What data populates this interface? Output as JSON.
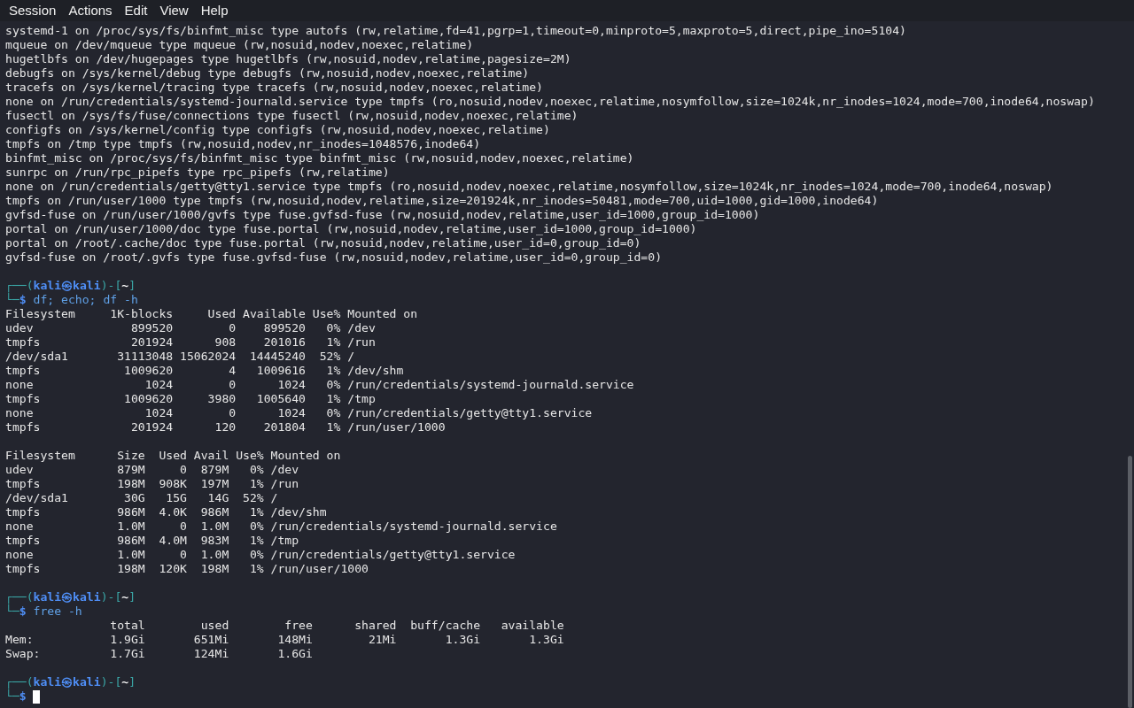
{
  "menu": [
    "Session",
    "Actions",
    "Edit",
    "View",
    "Help"
  ],
  "lines": [
    {
      "kind": "output",
      "text": "systemd-1 on /proc/sys/fs/binfmt_misc type autofs (rw,relatime,fd=41,pgrp=1,timeout=0,minproto=5,maxproto=5,direct,pipe_ino=5104)"
    },
    {
      "kind": "output",
      "text": "mqueue on /dev/mqueue type mqueue (rw,nosuid,nodev,noexec,relatime)"
    },
    {
      "kind": "output",
      "text": "hugetlbfs on /dev/hugepages type hugetlbfs (rw,nosuid,nodev,relatime,pagesize=2M)"
    },
    {
      "kind": "output",
      "text": "debugfs on /sys/kernel/debug type debugfs (rw,nosuid,nodev,noexec,relatime)"
    },
    {
      "kind": "output",
      "text": "tracefs on /sys/kernel/tracing type tracefs (rw,nosuid,nodev,noexec,relatime)"
    },
    {
      "kind": "output",
      "text": "none on /run/credentials/systemd-journald.service type tmpfs (ro,nosuid,nodev,noexec,relatime,nosymfollow,size=1024k,nr_inodes=1024,mode=700,inode64,noswap)"
    },
    {
      "kind": "output",
      "text": "fusectl on /sys/fs/fuse/connections type fusectl (rw,nosuid,nodev,noexec,relatime)"
    },
    {
      "kind": "output",
      "text": "configfs on /sys/kernel/config type configfs (rw,nosuid,nodev,noexec,relatime)"
    },
    {
      "kind": "output",
      "text": "tmpfs on /tmp type tmpfs (rw,nosuid,nodev,nr_inodes=1048576,inode64)"
    },
    {
      "kind": "output",
      "text": "binfmt_misc on /proc/sys/fs/binfmt_misc type binfmt_misc (rw,nosuid,nodev,noexec,relatime)"
    },
    {
      "kind": "output",
      "text": "sunrpc on /run/rpc_pipefs type rpc_pipefs (rw,relatime)"
    },
    {
      "kind": "output",
      "text": "none on /run/credentials/getty@tty1.service type tmpfs (ro,nosuid,nodev,noexec,relatime,nosymfollow,size=1024k,nr_inodes=1024,mode=700,inode64,noswap)"
    },
    {
      "kind": "output",
      "text": "tmpfs on /run/user/1000 type tmpfs (rw,nosuid,nodev,relatime,size=201924k,nr_inodes=50481,mode=700,uid=1000,gid=1000,inode64)"
    },
    {
      "kind": "output",
      "text": "gvfsd-fuse on /run/user/1000/gvfs type fuse.gvfsd-fuse (rw,nosuid,nodev,relatime,user_id=1000,group_id=1000)"
    },
    {
      "kind": "output",
      "text": "portal on /run/user/1000/doc type fuse.portal (rw,nosuid,nodev,relatime,user_id=1000,group_id=1000)"
    },
    {
      "kind": "output",
      "text": "portal on /root/.cache/doc type fuse.portal (rw,nosuid,nodev,relatime,user_id=0,group_id=0)"
    },
    {
      "kind": "output",
      "text": "gvfsd-fuse on /root/.gvfs type fuse.gvfsd-fuse (rw,nosuid,nodev,relatime,user_id=0,group_id=0)"
    },
    {
      "kind": "blank"
    },
    {
      "kind": "prompt",
      "open": "┌──(",
      "user": "kali",
      "at": "㉿",
      "host": "kali",
      "mid": ")-[",
      "dir": "~",
      "close": "]",
      "mark": "└─$",
      "command": "df; echo; df -h",
      "cursor": false
    },
    {
      "kind": "output",
      "text": "Filesystem     1K-blocks     Used Available Use% Mounted on"
    },
    {
      "kind": "output",
      "text": "udev              899520        0    899520   0% /dev"
    },
    {
      "kind": "output",
      "text": "tmpfs             201924      908    201016   1% /run"
    },
    {
      "kind": "output",
      "text": "/dev/sda1       31113048 15062024  14445240  52% /"
    },
    {
      "kind": "output",
      "text": "tmpfs            1009620        4   1009616   1% /dev/shm"
    },
    {
      "kind": "output",
      "text": "none                1024        0      1024   0% /run/credentials/systemd-journald.service"
    },
    {
      "kind": "output",
      "text": "tmpfs            1009620     3980   1005640   1% /tmp"
    },
    {
      "kind": "output",
      "text": "none                1024        0      1024   0% /run/credentials/getty@tty1.service"
    },
    {
      "kind": "output",
      "text": "tmpfs             201924      120    201804   1% /run/user/1000"
    },
    {
      "kind": "blank"
    },
    {
      "kind": "output",
      "text": "Filesystem      Size  Used Avail Use% Mounted on"
    },
    {
      "kind": "output",
      "text": "udev            879M     0  879M   0% /dev"
    },
    {
      "kind": "output",
      "text": "tmpfs           198M  908K  197M   1% /run"
    },
    {
      "kind": "output",
      "text": "/dev/sda1        30G   15G   14G  52% /"
    },
    {
      "kind": "output",
      "text": "tmpfs           986M  4.0K  986M   1% /dev/shm"
    },
    {
      "kind": "output",
      "text": "none            1.0M     0  1.0M   0% /run/credentials/systemd-journald.service"
    },
    {
      "kind": "output",
      "text": "tmpfs           986M  4.0M  983M   1% /tmp"
    },
    {
      "kind": "output",
      "text": "none            1.0M     0  1.0M   0% /run/credentials/getty@tty1.service"
    },
    {
      "kind": "output",
      "text": "tmpfs           198M  120K  198M   1% /run/user/1000"
    },
    {
      "kind": "blank"
    },
    {
      "kind": "prompt",
      "open": "┌──(",
      "user": "kali",
      "at": "㉿",
      "host": "kali",
      "mid": ")-[",
      "dir": "~",
      "close": "]",
      "mark": "└─$",
      "command": "free -h",
      "cursor": false
    },
    {
      "kind": "output",
      "text": "               total        used        free      shared  buff/cache   available"
    },
    {
      "kind": "output",
      "text": "Mem:           1.9Gi       651Mi       148Mi        21Mi       1.3Gi       1.3Gi"
    },
    {
      "kind": "output",
      "text": "Swap:          1.7Gi       124Mi       1.6Gi"
    },
    {
      "kind": "blank"
    },
    {
      "kind": "prompt",
      "open": "┌──(",
      "user": "kali",
      "at": "㉿",
      "host": "kali",
      "mid": ")-[",
      "dir": "~",
      "close": "]",
      "mark": "└─$",
      "cursor": true
    }
  ]
}
